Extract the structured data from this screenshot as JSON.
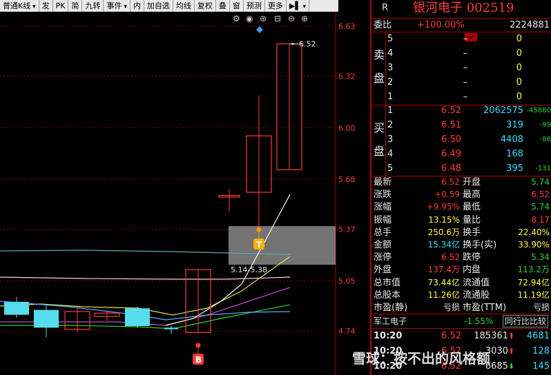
{
  "toolbar": {
    "items": [
      {
        "label": "普通K线",
        "dd": true
      },
      {
        "label": "发",
        "dd": false
      },
      {
        "label": "PK",
        "dd": false
      },
      {
        "label": "简",
        "dd": false
      },
      {
        "label": "九转",
        "dd": false
      },
      {
        "label": "事件",
        "dd": true
      },
      {
        "label": "内",
        "dd": false
      },
      {
        "label": "加自选",
        "dd": false
      },
      {
        "label": "均线",
        "dd": false
      },
      {
        "label": "复权",
        "dd": false
      },
      {
        "label": "叠",
        "dd": false
      },
      {
        "label": "窗",
        "dd": false
      },
      {
        "label": "预测",
        "dd": false
      },
      {
        "label": "更多",
        "dd": false
      },
      {
        "label": "▶▌",
        "dd": true
      }
    ]
  },
  "chart_tools": [
    "gear-icon",
    "eye-icon",
    "lock-icon",
    "minus-zoom-icon",
    "plus-zoom-icon",
    "close-icon"
  ],
  "price_axis": [
    "6.63",
    "6.32",
    "6.00",
    "5.68",
    "5.37",
    "5.05",
    "4.74"
  ],
  "chart_labels": {
    "high_label": "6.52",
    "range_label": "5.14-5.38",
    "t_marker": "T",
    "b_marker": "B"
  },
  "chart_data": {
    "type": "candlestick",
    "ylim": [
      4.6,
      6.7
    ],
    "candles": [
      {
        "open": 4.84,
        "close": 4.92,
        "high": 4.95,
        "low": 4.82,
        "fill": "cyan"
      },
      {
        "open": 4.87,
        "close": 4.76,
        "high": 4.9,
        "low": 4.7,
        "fill": "cyan"
      },
      {
        "open": 4.75,
        "close": 4.86,
        "high": 4.88,
        "low": 4.73,
        "fill": "hollow"
      },
      {
        "open": 4.83,
        "close": 4.85,
        "high": 4.86,
        "low": 4.8,
        "fill": "hollow"
      },
      {
        "open": 4.88,
        "close": 4.77,
        "high": 4.89,
        "low": 4.76,
        "fill": "cyan"
      },
      {
        "open": 4.76,
        "close": 4.75,
        "high": 4.77,
        "low": 4.72,
        "fill": "cyan"
      },
      {
        "open": 4.73,
        "close": 5.12,
        "high": 5.12,
        "low": 4.73,
        "fill": "hollow"
      },
      {
        "open": 5.58,
        "close": 5.57,
        "high": 5.62,
        "low": 5.48,
        "fill": "hollow"
      },
      {
        "open": 5.6,
        "close": 5.95,
        "high": 6.2,
        "low": 5.37,
        "fill": "hollow"
      },
      {
        "open": 5.74,
        "close": 6.52,
        "high": 6.52,
        "low": 5.74,
        "fill": "hollow"
      }
    ]
  },
  "header": {
    "r_label": "R",
    "title": "银河电子 002519"
  },
  "weibi": {
    "label": "委比",
    "pct": "+100.00%",
    "vol": "2224881"
  },
  "sell": {
    "side_label_1": "卖",
    "side_label_2": "盘",
    "rows": [
      {
        "lvl": "5",
        "price": "–",
        "vol": "0"
      },
      {
        "lvl": "4",
        "price": "–",
        "vol": "0"
      },
      {
        "lvl": "3",
        "price": "–",
        "vol": "0"
      },
      {
        "lvl": "2",
        "price": "–",
        "vol": "0"
      },
      {
        "lvl": "1",
        "price": "–",
        "vol": "0"
      }
    ]
  },
  "buy": {
    "side_label_1": "买",
    "side_label_2": "盘",
    "rows": [
      {
        "lvl": "1",
        "price": "6.52",
        "vol": "2062575",
        "chg": "-45880"
      },
      {
        "lvl": "2",
        "price": "6.51",
        "vol": "319",
        "chg": "-99"
      },
      {
        "lvl": "3",
        "price": "6.50",
        "vol": "4408",
        "chg": "-86"
      },
      {
        "lvl": "4",
        "price": "6.49",
        "vol": "168",
        "chg": ""
      },
      {
        "lvl": "5",
        "price": "6.48",
        "vol": "395",
        "chg": "-131"
      }
    ]
  },
  "stats": [
    {
      "k1": "最新",
      "v1": "6.52",
      "c1": "red",
      "k2": "开盘",
      "v2": "5.74",
      "c2": "green"
    },
    {
      "k1": "涨跌",
      "v1": "+0.59",
      "c1": "red",
      "k2": "最高",
      "v2": "6.52",
      "c2": "red"
    },
    {
      "k1": "涨幅",
      "v1": "+9.95%",
      "c1": "red",
      "k2": "最低",
      "v2": "5.74",
      "c2": "green"
    },
    {
      "k1": "振幅",
      "v1": "13.15%",
      "c1": "yellow",
      "k2": "量比",
      "v2": "8.17",
      "c2": "red"
    },
    {
      "k1": "总手",
      "v1": "250.6万",
      "c1": "yellow",
      "k2": "换手",
      "v2": "22.40%",
      "c2": "yellow"
    },
    {
      "k1": "金额",
      "v1": "15.34亿",
      "c1": "cyan",
      "k2": "换手(实)",
      "v2": "33.90%",
      "c2": "yellow"
    },
    {
      "k1": "涨停",
      "v1": "6.52",
      "c1": "red",
      "k2": "跌停",
      "v2": "5.34",
      "c2": "green"
    },
    {
      "k1": "外盘",
      "v1": "137.4万",
      "c1": "red",
      "k2": "内盘",
      "v2": "113.2万",
      "c2": "green"
    },
    {
      "k1": "总市值",
      "v1": "73.44亿",
      "c1": "yellow",
      "k2": "流通值",
      "v2": "72.94亿",
      "c2": "yellow"
    },
    {
      "k1": "总股本",
      "v1": "11.26亿",
      "c1": "yellow",
      "k2": "流通股",
      "v2": "11.19亿",
      "c2": "yellow"
    },
    {
      "k1": "市盈(静)",
      "v1": "亏损",
      "c1": "white",
      "k2": "市盈(TTM)",
      "v2": "亏损",
      "c2": "white"
    }
  ],
  "sector": {
    "name": "军工电子",
    "chg": "-1.55%",
    "compare": "同行比比较"
  },
  "ticks": [
    {
      "time": "10:20",
      "price": "6.52",
      "vol": "185361",
      "dir": "up",
      "n": "4681"
    },
    {
      "time": "10:20",
      "price": "6.52",
      "vol": "3030",
      "dir": "up",
      "n": "128"
    },
    {
      "time": "10:20",
      "price": "6.52",
      "vol": "6685",
      "dir": "down",
      "n": "145"
    }
  ],
  "watermark": "雪球：按不出的风格额",
  "colors": {
    "up": "#ff3b3b",
    "down": "#2fd52f",
    "cyan": "#35e0ff",
    "yellow": "#ffff40",
    "border": "#b00000"
  }
}
